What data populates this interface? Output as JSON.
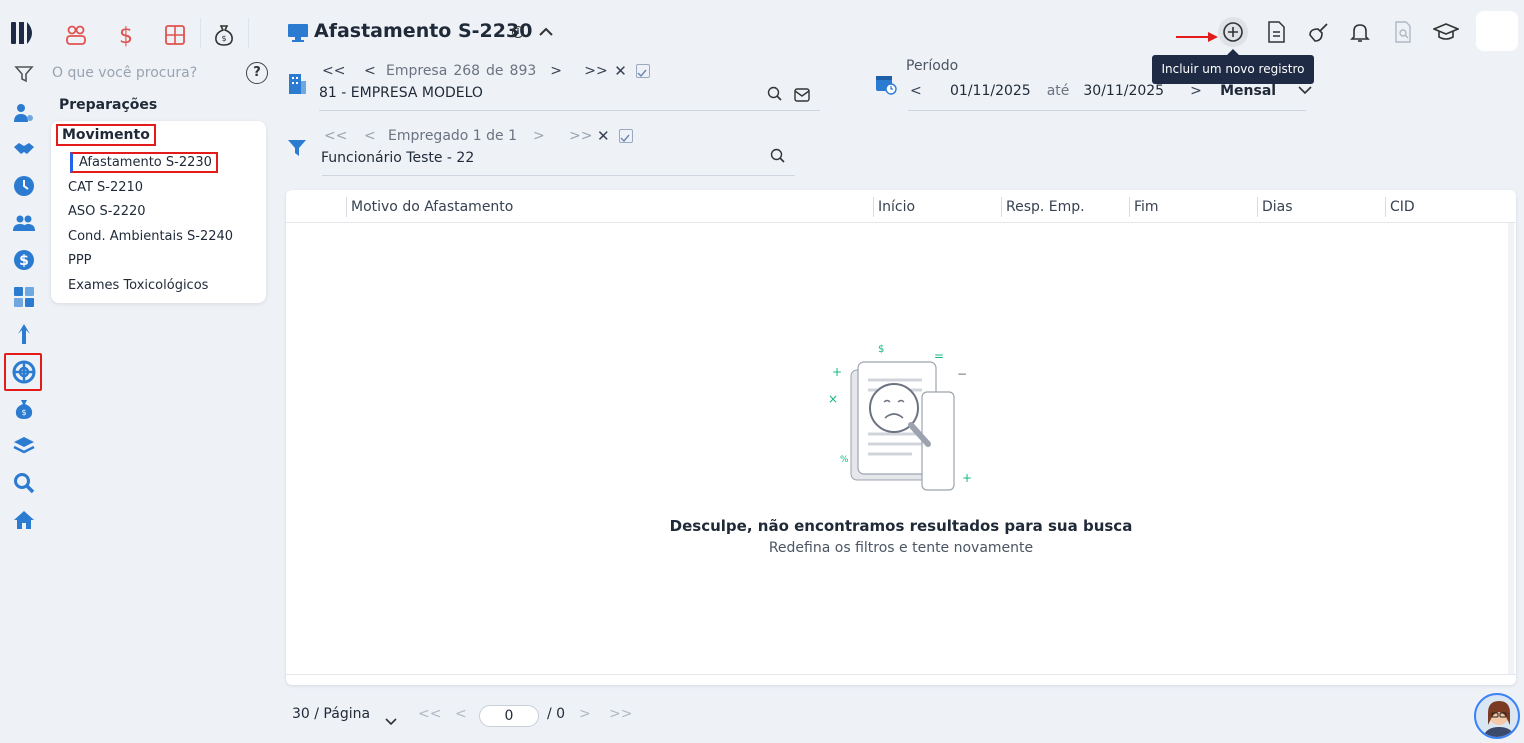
{
  "search": {
    "placeholder": "O que você procura?",
    "help": "?"
  },
  "menu": {
    "group_title": "Preparações",
    "section": "Movimento",
    "items": [
      {
        "label": "Afastamento S-2230",
        "active": true
      },
      {
        "label": "CAT S-2210"
      },
      {
        "label": "ASO S-2220"
      },
      {
        "label": "Cond. Ambientais S-2240"
      },
      {
        "label": "PPP"
      },
      {
        "label": "Exames Toxicológicos"
      }
    ]
  },
  "page": {
    "title": "Afastamento S-2230",
    "info": "i"
  },
  "tooltip": "Incluir um novo registro",
  "empresa": {
    "first": "<<",
    "prev": "<",
    "label": "Empresa",
    "current": "268",
    "of": "de",
    "total": "893",
    "next": ">",
    "last": ">>",
    "clear": "✕",
    "value": "81 - EMPRESA MODELO"
  },
  "empregado": {
    "first": "<<",
    "prev": "<",
    "label": "Empregado 1 de 1",
    "next": ">",
    "last": ">>",
    "clear": "✕",
    "value": "Funcionário Teste - 22"
  },
  "periodo": {
    "label": "Período",
    "prev": "<",
    "start": "01/11/2025",
    "until": "até",
    "end": "30/11/2025",
    "next": ">",
    "mode": "Mensal"
  },
  "grid": {
    "columns": [
      "Motivo do Afastamento",
      "Início",
      "Resp. Emp.",
      "Fim",
      "Dias",
      "CID"
    ],
    "empty_title": "Desculpe, não encontramos resultados para sua busca",
    "empty_sub": "Redefina os filtros e tente novamente",
    "illus_symbols": {
      "dollar": "$",
      "equals": "=",
      "plus": "+",
      "minus": "−",
      "times": "×",
      "percent": "%"
    }
  },
  "pager": {
    "per_page": "30 / Página",
    "first": "<<",
    "prev": "<",
    "page": "0",
    "sep": "/ 0",
    "next": ">",
    "last": ">>"
  },
  "colors": {
    "accent": "#2563eb",
    "highlight": "#e31b1b",
    "tooltip": "#1f2a44",
    "module_red": "#e0524f"
  }
}
